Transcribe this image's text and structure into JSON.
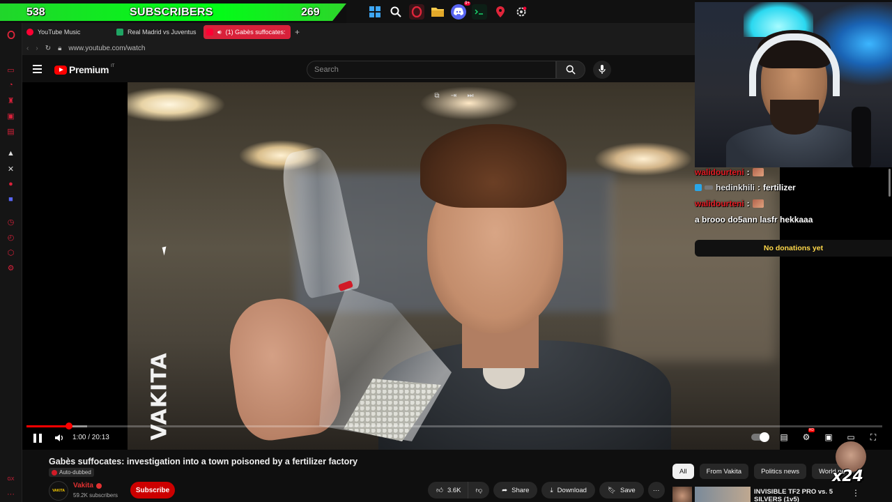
{
  "overlay": {
    "subscriber_count_left": "538",
    "subscriber_label": "SUBSCRIBERS",
    "subscriber_count_right": "269",
    "chat": [
      {
        "user": "walidourteni",
        "message": ""
      },
      {
        "user": "hedinkhili",
        "message": "fertilizer"
      },
      {
        "user": "walidourteni",
        "message": ""
      },
      {
        "user": "",
        "message": "a brooo do5ann lasfr hekkaaa"
      }
    ],
    "donations": "No donations yet",
    "multiplier": "x24"
  },
  "taskbar": {
    "icons": [
      "windows-icon",
      "search-icon",
      "opera-gx-icon",
      "file-explorer-icon",
      "discord-icon",
      "terminal-icon",
      "maps-pin-icon",
      "settings-icon"
    ],
    "discord_badge": "9+"
  },
  "browser": {
    "tabs": [
      {
        "title": "YouTube Music",
        "active": false
      },
      {
        "title": "Real Madrid vs Juventus",
        "active": false
      },
      {
        "title": "(1) Gabès suffocates:",
        "active": true
      }
    ],
    "url": "www.youtube.com/watch"
  },
  "youtube": {
    "logo_text": "Premium",
    "logo_region": "IT",
    "search_placeholder": "Search",
    "video": {
      "watermark": "VAKITA",
      "current_time": "1:00 / 20:13",
      "progress_fraction": 0.0495,
      "buffered_fraction": 0.071
    },
    "title": "Gabès suffocates: investigation into a town poisoned by a fertilizer factory",
    "auto_dubbed": "Auto-dubbed",
    "channel": {
      "avatar_text": "VAKITA",
      "name": "Vakita",
      "subscribers": "59.2K subscribers",
      "subscribe_label": "Subscribe"
    },
    "actions": {
      "likes": "3.6K",
      "share": "Share",
      "download": "Download",
      "save": "Save"
    },
    "chips": [
      {
        "label": "All",
        "active": true
      },
      {
        "label": "From Vakita",
        "active": false
      },
      {
        "label": "Politics news",
        "active": false
      },
      {
        "label": "World news",
        "active": false
      }
    ],
    "recommendation": {
      "title": "INVISIBLE TF2 PRO vs. 5 SILVERS (1v5)"
    }
  }
}
